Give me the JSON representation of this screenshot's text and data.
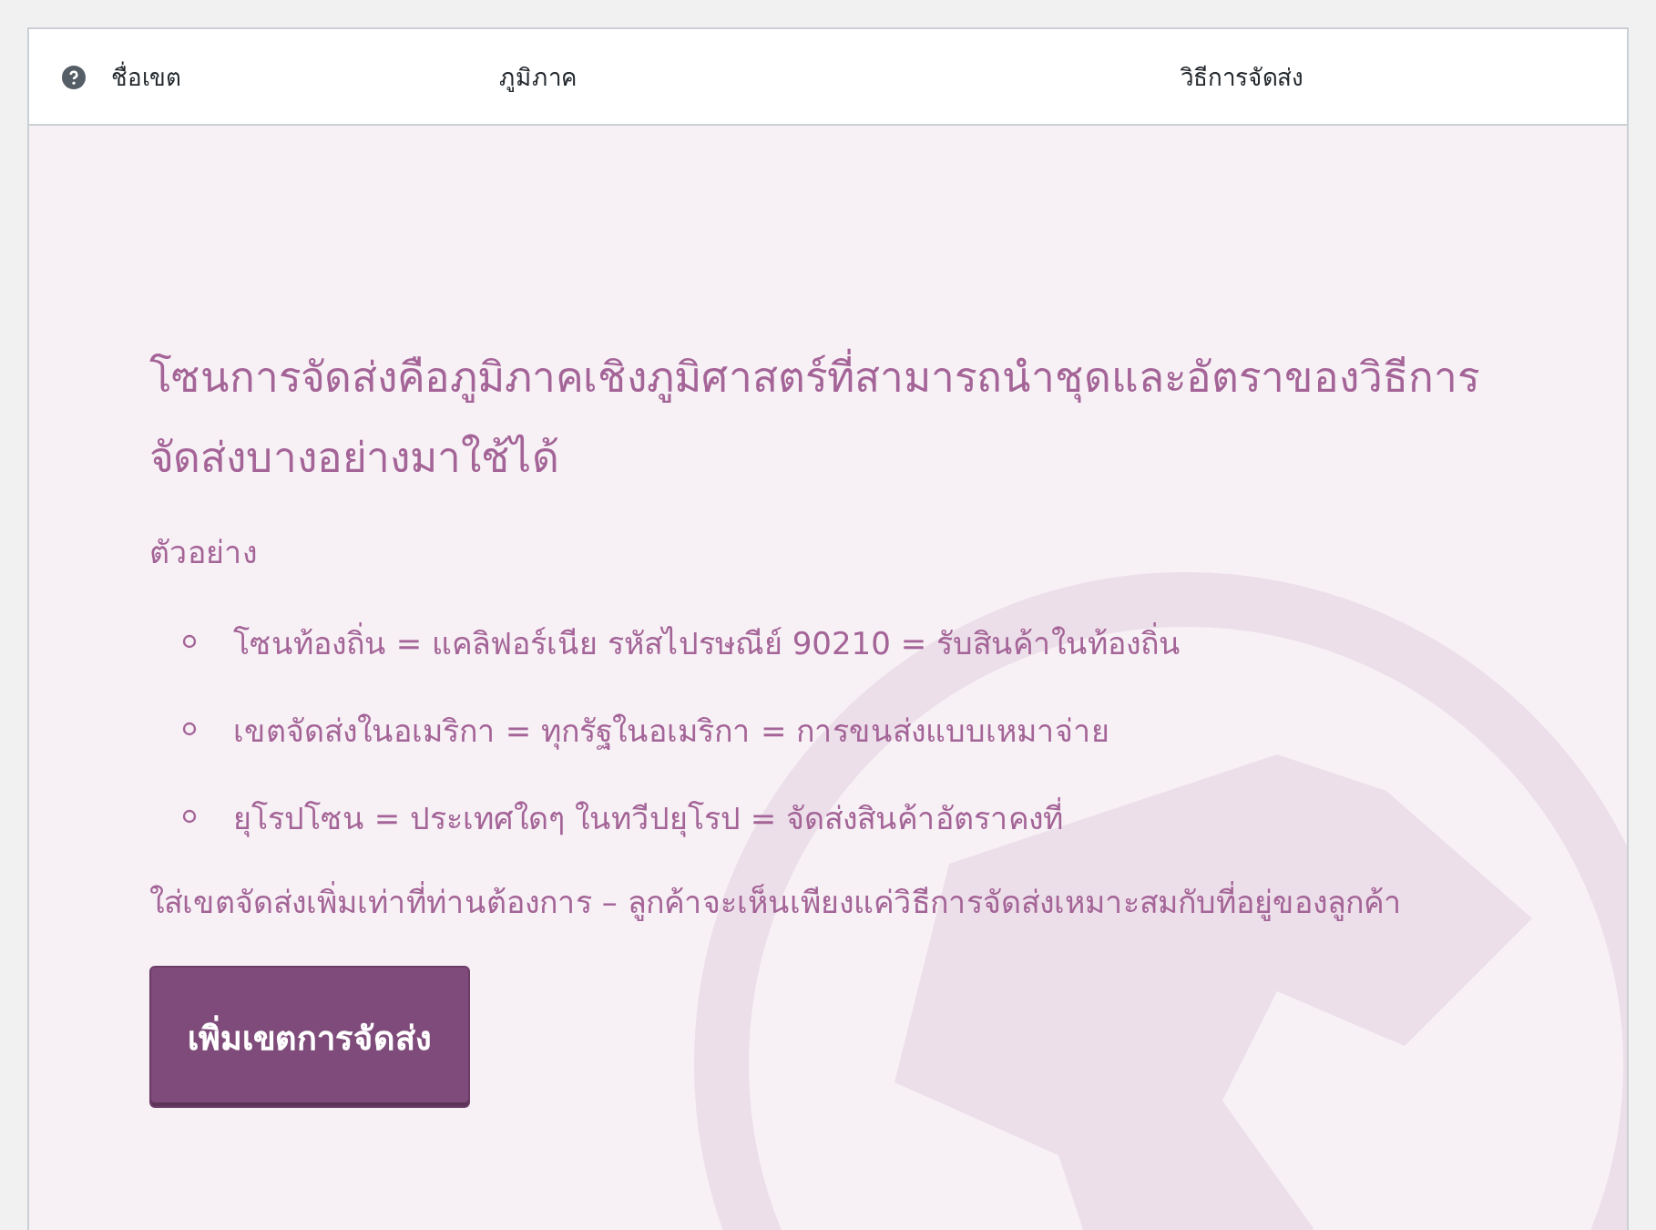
{
  "table": {
    "columns": [
      {
        "kind": "help"
      },
      {
        "kind": "text",
        "label": "ชื่อเขต"
      },
      {
        "kind": "text",
        "label": "ภูมิภาค"
      },
      {
        "kind": "text",
        "label": "วิธีการจัดส่ง"
      }
    ]
  },
  "empty_state": {
    "heading": "โซนการจัดส่งคือภูมิภาคเชิงภูมิศาสตร์ที่สามารถนำชุดและอัตราของวิธีการจัดส่งบางอย่างมาใช้ได้",
    "examples_label": "ตัวอย่าง",
    "examples": [
      "โซนท้องถิ่น = แคลิฟอร์เนีย รหัสไปรษณีย์ 90210 = รับสินค้าในท้องถิ่น",
      "เขตจัดส่งในอเมริกา = ทุกรัฐในอเมริกา = การขนส่งแบบเหมาจ่าย",
      "ยุโรปโซน = ประเทศใดๆ ในทวีปยุโรป = จัดส่งสินค้าอัตราคงที่"
    ],
    "note": "ใส่เขตจัดส่งเพิ่มเท่าที่ท่านต้องการ – ลูกค้าจะเห็นเพียงแค่วิธีการจัดส่งเหมาะสมกับที่อยู่ของลูกค้า",
    "button": "เพิ่มเขตการจัดส่ง"
  }
}
